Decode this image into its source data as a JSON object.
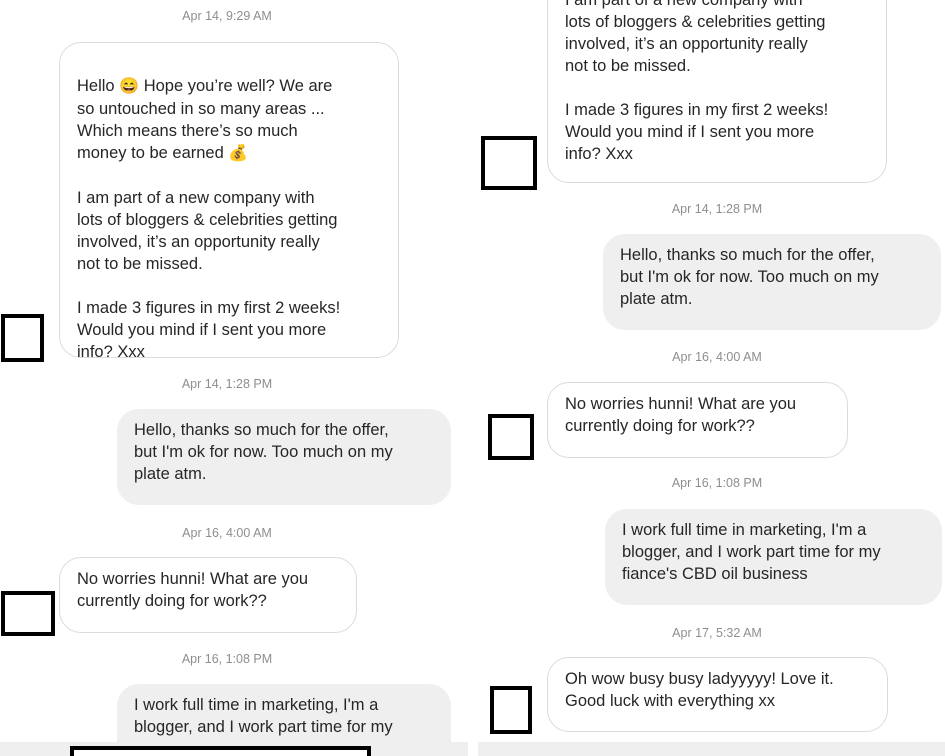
{
  "left": {
    "ts1": "Apr 14, 9:29 AM",
    "msg1_line1": "Hello ",
    "msg1_emoji1": "😄",
    "msg1_line1b": " Hope you’re well? We are",
    "msg1_rest": "so untouched in so many areas ...\nWhich means there’s so much\nmoney to be earned ",
    "msg1_emoji2": "💰",
    "msg1_p2": "I am part of a new company with\nlots of bloggers & celebrities getting\ninvolved, it’s an opportunity really\nnot to be missed.\n\nI made 3 figures in my first 2 weeks!\nWould you mind if I sent you more\ninfo? Xxx",
    "ts2": "Apr 14, 1:28 PM",
    "msg2": "Hello, thanks so much for the offer,\nbut I'm ok for now. Too much on my\nplate atm.",
    "ts3": "Apr 16, 4:00 AM",
    "msg3": "No worries hunni! What are you\ncurrently doing for work??",
    "ts4": "Apr 16, 1:08 PM",
    "msg4": "I work full time in marketing, I'm a\nblogger, and I work part time for my"
  },
  "right": {
    "msg1_top": "I am part of a new company with\nlots of bloggers & celebrities getting\ninvolved, it’s an opportunity really\nnot to be missed.\n\nI made 3 figures in my first 2 weeks!\nWould you mind if I sent you more\ninfo? Xxx",
    "ts2": "Apr 14, 1:28 PM",
    "msg2": "Hello, thanks so much for the offer,\nbut I'm ok for now. Too much on my\nplate atm.",
    "ts3": "Apr 16, 4:00 AM",
    "msg3": "No worries hunni! What are you\ncurrently doing for work??",
    "ts4": "Apr 16, 1:08 PM",
    "msg4": "I work full time in marketing, I'm a\nblogger, and I work part time for my\nfiance's CBD oil business",
    "ts5": "Apr 17, 5:32 AM",
    "msg5": "Oh wow busy busy ladyyyyy! Love it.\nGood luck with everything xx"
  },
  "icons": {
    "avatar": "avatar-placeholder-icon",
    "emoji_grin": "grinning-face-icon",
    "emoji_money": "money-bag-icon"
  },
  "colors": {
    "incoming_bubble": "#ffffff",
    "incoming_border": "#dbdbdb",
    "outgoing_bubble": "#efefef",
    "timestamp": "#8e8e8e",
    "text": "#262626"
  }
}
